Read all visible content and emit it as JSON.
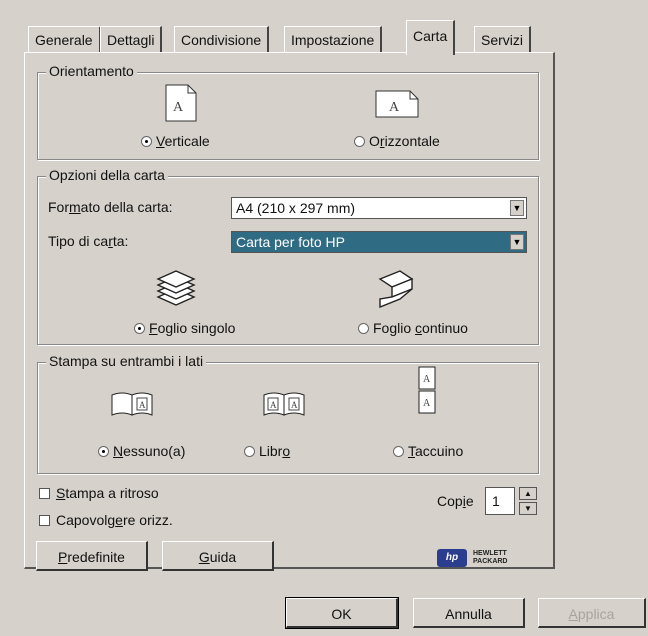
{
  "tabs": [
    "Generale",
    "Dettagli",
    "Condivisione",
    "Impostazione",
    "Carta",
    "Servizi"
  ],
  "active_tab": "Carta",
  "orientation": {
    "title": "Orientamento",
    "options": [
      {
        "label": "Verticale",
        "underline": "V",
        "rest": "erticale",
        "selected": true
      },
      {
        "label": "Orizzontale",
        "pre": "O",
        "underline": "r",
        "rest": "izzontale",
        "selected": false
      }
    ]
  },
  "paper": {
    "title": "Opzioni della carta",
    "format_label_pre": "For",
    "format_label_u": "m",
    "format_label_rest": "ato della carta:",
    "format_value": "A4 (210 x 297 mm)",
    "type_label_pre": "Tipo di ca",
    "type_label_u": "r",
    "type_label_rest": "ta:",
    "type_value": "Carta per foto HP",
    "feed_options": [
      {
        "u": "F",
        "rest": "oglio singolo",
        "selected": true
      },
      {
        "pre": "Foglio ",
        "u": "c",
        "rest": "ontinuo",
        "selected": false
      }
    ]
  },
  "duplex": {
    "title": "Stampa su entrambi i lati",
    "options": [
      {
        "u": "N",
        "rest": "essuno(a)",
        "selected": true
      },
      {
        "pre": "Libr",
        "u": "o",
        "rest": "",
        "selected": false
      },
      {
        "u": "T",
        "rest": "accuino",
        "selected": false
      }
    ]
  },
  "checkbox_reverse": {
    "u": "S",
    "rest": "tampa a ritroso",
    "checked": false
  },
  "checkbox_flip": {
    "pre": "Capovolg",
    "u": "e",
    "rest": "re orizz.",
    "checked": false
  },
  "copies": {
    "pre": "Cop",
    "u": "i",
    "rest": "e",
    "value": "1"
  },
  "buttons": {
    "defaults": {
      "u": "P",
      "rest": "redefinite"
    },
    "help": {
      "u": "G",
      "rest": "uida"
    },
    "ok": "OK",
    "cancel": "Annulla",
    "apply": {
      "u": "A",
      "rest": "pplica"
    }
  },
  "brand": {
    "mark": "hp",
    "line1": "HEWLETT",
    "line2": "PACKARD",
    "color": "#2a3d8f"
  }
}
